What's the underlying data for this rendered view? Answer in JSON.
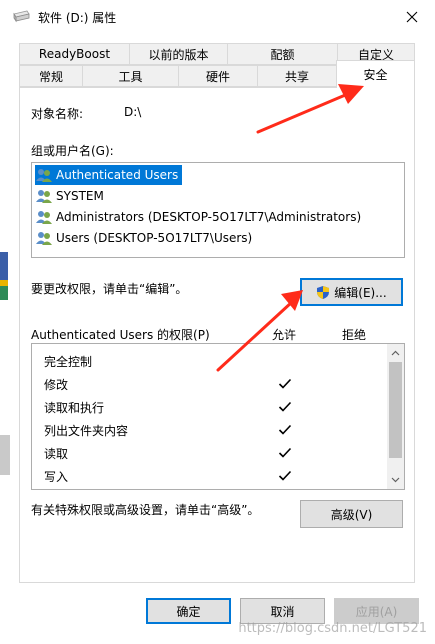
{
  "window": {
    "title": "软件 (D:) 属性",
    "drive_icon": "drive-icon",
    "close_icon": "close-icon"
  },
  "tabs_top": [
    "ReadyBoost",
    "以前的版本",
    "配额",
    "自定义"
  ],
  "tabs_bottom": [
    "常规",
    "工具",
    "硬件",
    "共享",
    "安全"
  ],
  "active_tab": "安全",
  "security": {
    "object_label": "对象名称:",
    "object_value": "D:\\",
    "groups_label": "组或用户名(G):",
    "users": [
      "Authenticated Users",
      "SYSTEM",
      "Administrators (DESKTOP-5O17LT7\\Administrators)",
      "Users (DESKTOP-5O17LT7\\Users)"
    ],
    "selected_user": "Authenticated Users",
    "change_hint": "要更改权限，请单击“编辑”。",
    "edit_button": "编辑(E)...",
    "perm_header": "Authenticated Users 的权限(P)",
    "allow_header": "允许",
    "deny_header": "拒绝",
    "permissions": [
      {
        "name": "完全控制",
        "allow": false
      },
      {
        "name": "修改",
        "allow": true
      },
      {
        "name": "读取和执行",
        "allow": true
      },
      {
        "name": "列出文件夹内容",
        "allow": true
      },
      {
        "name": "读取",
        "allow": true
      },
      {
        "name": "写入",
        "allow": true
      }
    ],
    "advanced_hint": "有关特殊权限或高级设置，请单击“高级”。",
    "advanced_button": "高级(V)"
  },
  "footer": {
    "ok": "确定",
    "cancel": "取消",
    "apply": "应用(A)"
  },
  "watermark": "https://blog.csdn.net/LGT521",
  "colors": {
    "selection": "#0078d7",
    "annotation_arrow": "#ff2b1a"
  }
}
